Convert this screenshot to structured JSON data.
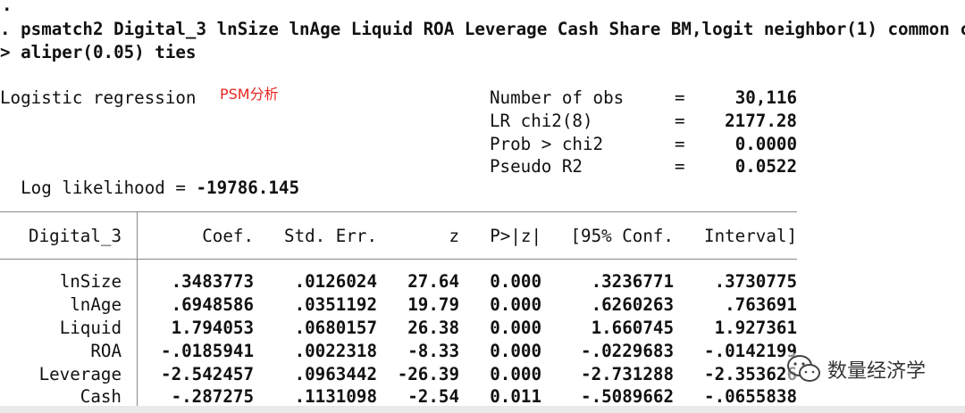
{
  "prompt_dot": ".",
  "command_line1": ". psmatch2 Digital_3 lnSize lnAge Liquid ROA Leverage Cash Share BM,logit neighbor(1) common c",
  "command_line2": "> aliper(0.05) ties",
  "header": {
    "title": "Logistic regression",
    "annotation": "PSM分析",
    "log_likelihood_label": "Log likelihood = ",
    "log_likelihood_value": "-19786.145",
    "stats": [
      {
        "label": "Number of obs",
        "eq": "=",
        "value": "30,116"
      },
      {
        "label": "LR chi2(8)",
        "eq": "=",
        "value": "2177.28"
      },
      {
        "label": "Prob > chi2",
        "eq": "=",
        "value": "0.0000"
      },
      {
        "label": "Pseudo R2",
        "eq": "=",
        "value": "0.0522"
      }
    ]
  },
  "table": {
    "dep_var": "Digital_3",
    "columns": [
      "Coef.",
      "Std. Err.",
      "z",
      "P>|z|",
      "[95% Conf.",
      "Interval]"
    ],
    "rows": [
      {
        "var": "lnSize",
        "cells": [
          ".3483773",
          ".0126024",
          "27.64",
          "0.000",
          ".3236771",
          ".3730775"
        ]
      },
      {
        "var": "lnAge",
        "cells": [
          ".6948586",
          ".0351192",
          "19.79",
          "0.000",
          ".6260263",
          ".763691"
        ]
      },
      {
        "var": "Liquid",
        "cells": [
          "1.794053",
          ".0680157",
          "26.38",
          "0.000",
          "1.660745",
          "1.927361"
        ]
      },
      {
        "var": "ROA",
        "cells": [
          "-.0185941",
          ".0022318",
          "-8.33",
          "0.000",
          "-.0229683",
          "-.0142199"
        ]
      },
      {
        "var": "Leverage",
        "cells": [
          "-2.542457",
          ".0963442",
          "-26.39",
          "0.000",
          "-2.731288",
          "-2.353626"
        ]
      },
      {
        "var": "Cash",
        "cells": [
          "-.287275",
          ".1131098",
          "-2.54",
          "0.011",
          "-.5089662",
          "-.0655838"
        ]
      }
    ]
  },
  "watermark": {
    "text": "数量经济学",
    "icon": "wechat-icon"
  }
}
